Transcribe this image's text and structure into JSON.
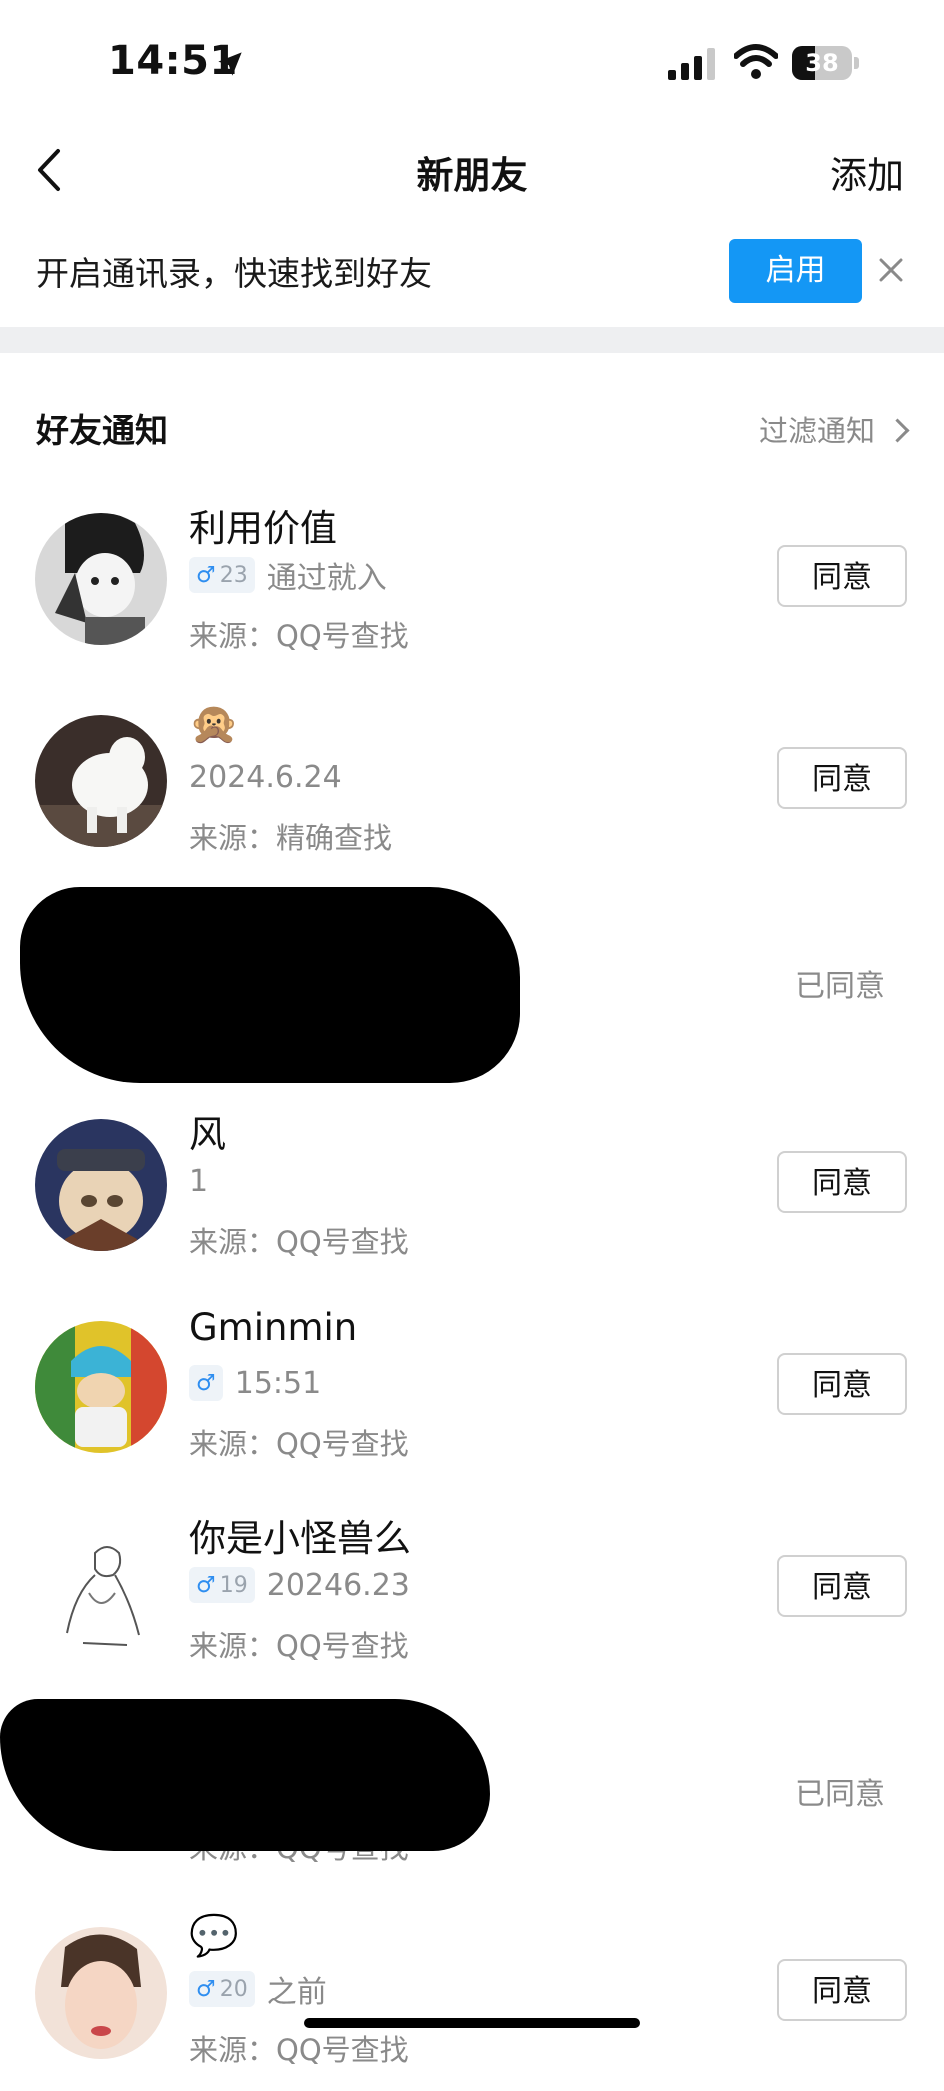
{
  "status_bar": {
    "time": "14:51",
    "battery": "38",
    "battery_level": 0.38
  },
  "nav": {
    "title": "新朋友",
    "add_label": "添加"
  },
  "banner": {
    "text": "开启通讯录，快速找到好友",
    "enable_label": "启用"
  },
  "section": {
    "title": "好友通知",
    "filter_label": "过滤通知"
  },
  "requests": [
    {
      "name": "利用价值",
      "gender": "♂",
      "age": "23",
      "message": "通过就入",
      "source": "来源：QQ号查找",
      "action": "同意"
    },
    {
      "name": "🙊",
      "message": "2024.6.24",
      "source": "来源：精确查找",
      "action": "同意"
    },
    {
      "redacted": true,
      "action": "已同意"
    },
    {
      "name": "风",
      "message": "1",
      "source": "来源：QQ号查找",
      "action": "同意"
    },
    {
      "name": "Gminmin",
      "gender": "♂",
      "message": "15:51",
      "source": "来源：QQ号查找",
      "action": "同意"
    },
    {
      "name": "你是小怪兽么",
      "gender": "♂",
      "age": "19",
      "message": "20246.23",
      "source": "来源：QQ号查找",
      "action": "同意"
    },
    {
      "redacted": true,
      "source": "来源：QQ号查找",
      "action": "已同意"
    },
    {
      "name": "💬",
      "gender": "♂",
      "age": "20",
      "message": "之前",
      "source": "来源：QQ号查找",
      "action": "同意"
    }
  ],
  "colors": {
    "accent": "#1497f5",
    "muted_text": "#8a8a8a",
    "divider": "#eeeff1",
    "gender_male": "#2f8ef0"
  }
}
